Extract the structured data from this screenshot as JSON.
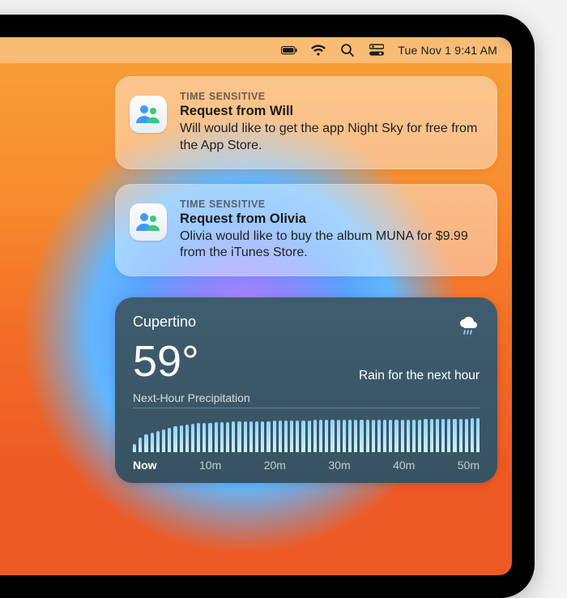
{
  "menubar": {
    "datetime": "Tue Nov 1  9:41 AM"
  },
  "notifications": [
    {
      "tag": "TIME SENSITIVE",
      "title": "Request from Will",
      "message": "Will would like to get the app Night Sky for free from the App Store."
    },
    {
      "tag": "TIME SENSITIVE",
      "title": "Request from Olivia",
      "message": "Olivia would like to buy the album MUNA for $9.99 from the iTunes Store."
    }
  ],
  "weather": {
    "city": "Cupertino",
    "temp": "59°",
    "summary": "Rain for the next hour",
    "precip_label": "Next-Hour Precipitation",
    "timeline": [
      "Now",
      "10m",
      "20m",
      "30m",
      "40m",
      "50m"
    ],
    "bars": [
      10,
      18,
      22,
      24,
      26,
      28,
      30,
      32,
      33,
      34,
      35,
      36,
      36,
      36,
      37,
      37,
      37,
      38,
      38,
      38,
      38,
      38,
      38,
      38,
      39,
      39,
      39,
      39,
      39,
      39,
      39,
      40,
      40,
      40,
      40,
      40,
      40,
      40,
      40,
      40,
      40,
      40,
      40,
      40,
      40,
      40,
      40,
      40,
      40,
      40,
      41,
      41,
      41,
      41,
      41,
      41,
      41,
      41,
      42,
      42
    ]
  }
}
